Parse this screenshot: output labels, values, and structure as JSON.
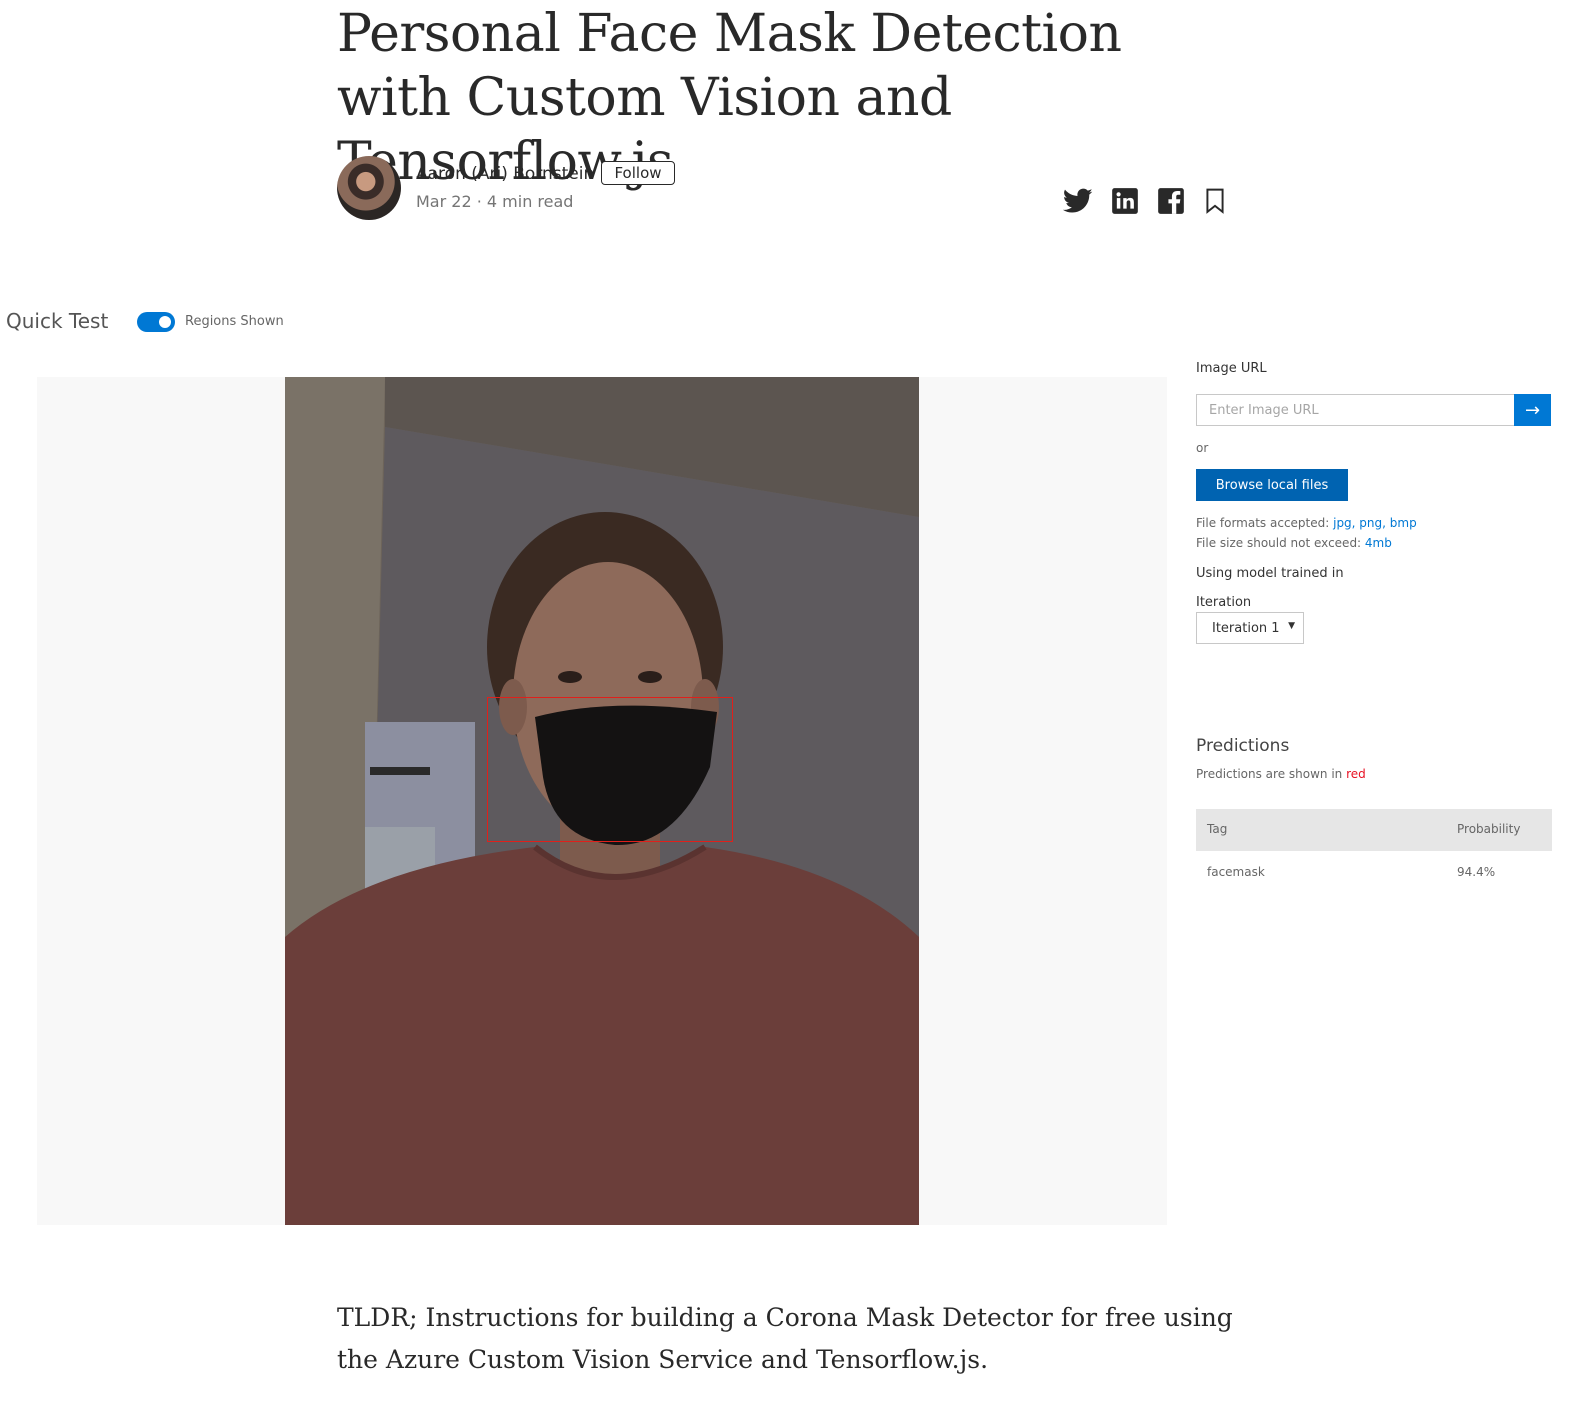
{
  "article": {
    "title": "Personal Face Mask Detection with Custom Vision and Tensorflow.js",
    "author": "Aaron (Ari) Bornstein",
    "follow_label": "Follow",
    "meta": "Mar 22 · 4 min read",
    "share_icons": [
      "twitter-icon",
      "linkedin-icon",
      "facebook-icon",
      "bookmark-icon"
    ],
    "intro": "TLDR; Instructions for building a Corona Mask Detector for free using the Azure Custom Vision Service and Tensorflow.js."
  },
  "quick_test": {
    "title": "Quick Test",
    "toggle_label": "Regions Shown",
    "toggle_on": true,
    "image_url_label": "Image URL",
    "image_url_placeholder": "Enter Image URL",
    "image_url_value": "",
    "or_label": "or",
    "browse_label": "Browse local files",
    "formats_prefix": "File formats accepted: ",
    "formats": "jpg, png, bmp",
    "size_prefix": "File size should not exceed: ",
    "size_limit": "4mb",
    "model_label": "Using model trained in",
    "iteration_label": "Iteration",
    "iteration_value": "Iteration 1",
    "predictions_title": "Predictions",
    "predictions_note_prefix": "Predictions are shown in ",
    "predictions_note_color": "red",
    "table_headers": {
      "tag": "Tag",
      "probability": "Probability"
    },
    "rows": [
      {
        "tag": "facemask",
        "probability": "94.4%"
      }
    ]
  },
  "colors": {
    "accent": "#0078d4",
    "button": "#0063b1",
    "region_box": "#e0201b",
    "text": "#292929",
    "muted": "#757575"
  }
}
